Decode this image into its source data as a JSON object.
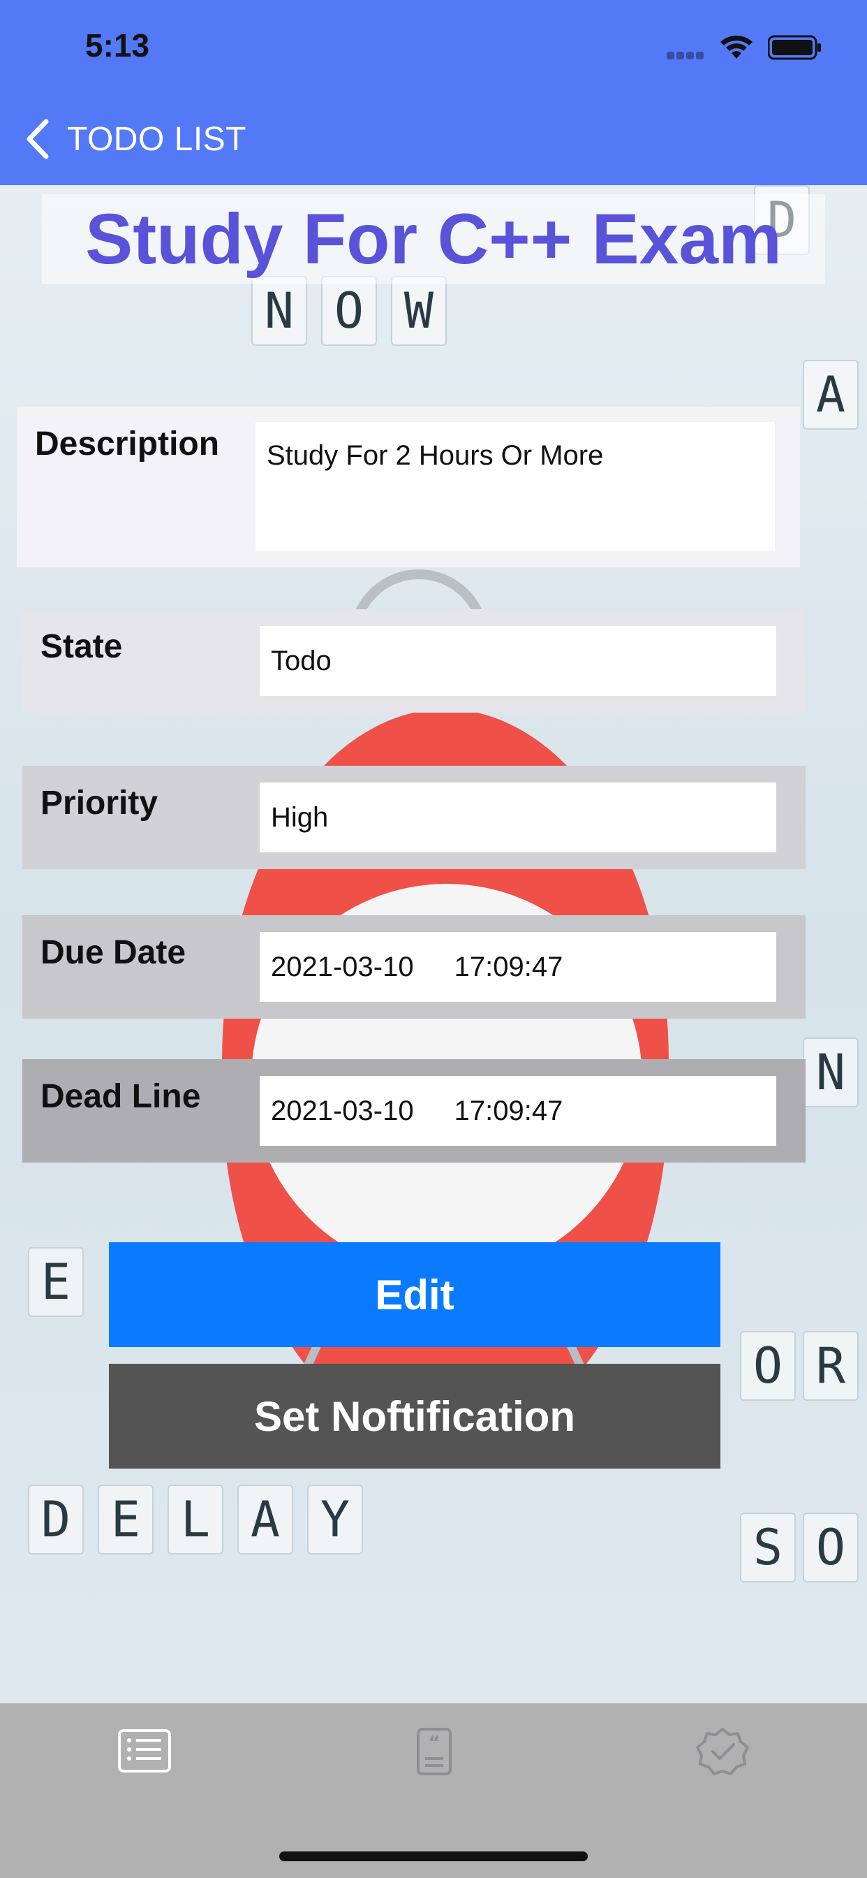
{
  "status_bar": {
    "time": "5:13"
  },
  "nav": {
    "back_label": "TODO LIST"
  },
  "task": {
    "title": "Study For C++ Exam",
    "fields": {
      "description": {
        "label": "Description",
        "value": "Study For 2 Hours Or More"
      },
      "state": {
        "label": "State",
        "value": "Todo"
      },
      "priority": {
        "label": "Priority",
        "value": "High"
      },
      "due_date": {
        "label": "Due Date",
        "date": "2021-03-10",
        "time": "17:09:47"
      },
      "dead_line": {
        "label": "Dead Line",
        "date": "2021-03-10",
        "time": "17:09:47"
      }
    }
  },
  "actions": {
    "edit_label": "Edit",
    "notify_label": "Set Noftification"
  },
  "tabbar": {
    "icons": [
      "list-icon",
      "quotes-icon",
      "checkmark-badge-icon"
    ]
  },
  "colors": {
    "header": "#5479f7",
    "title": "#5a52d8",
    "edit_button": "#0a7bff",
    "notify_button": "#545454",
    "tabbar": "#b1b1b1"
  }
}
